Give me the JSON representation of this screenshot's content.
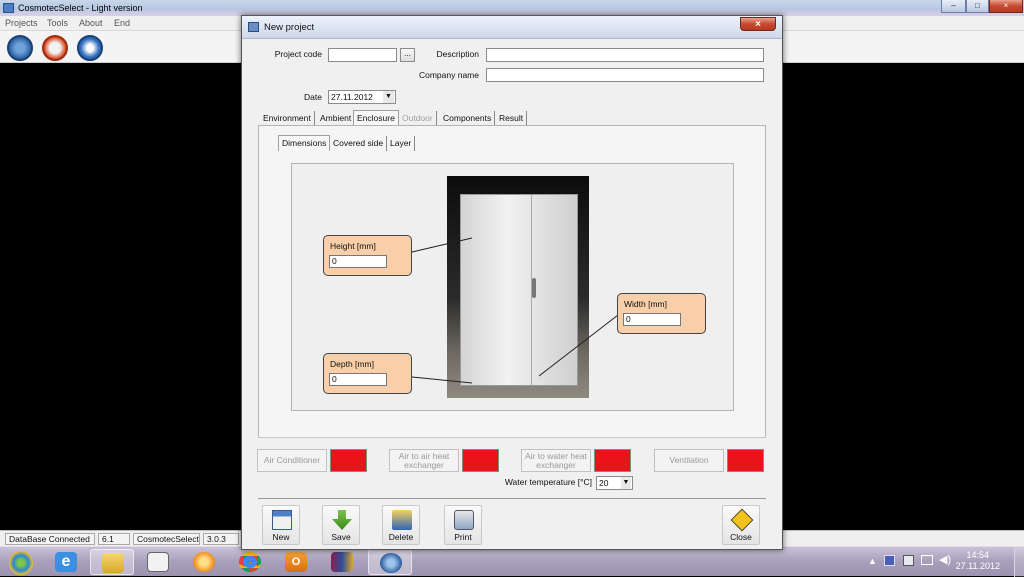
{
  "app": {
    "title": "CosmotecSelect - Light version",
    "menu": [
      "Projects",
      "Tools",
      "About",
      "End"
    ]
  },
  "status": {
    "connection": "DataBase Connected",
    "db_version": "6.1",
    "app_name": "CosmotecSelect",
    "app_version": "3.0.3"
  },
  "dialog": {
    "title": "New project",
    "close_label": "×",
    "project_code_label": "Project code",
    "project_code_value": "",
    "browse_label": "...",
    "description_label": "Description",
    "description_value": "",
    "company_label": "Company name",
    "company_value": "",
    "date_label": "Date",
    "date_value": "27.11.2012",
    "tabs": [
      "Environment",
      "Ambient",
      "Enclosure",
      "Outdoor",
      "Components",
      "Result"
    ],
    "subtabs": [
      "Dimensions",
      "Covered side",
      "Layer"
    ],
    "height_label": "Height [mm]",
    "height_value": "0",
    "width_label": "Width [mm]",
    "width_value": "0",
    "depth_label": "Depth [mm]",
    "depth_value": "0",
    "systems": {
      "air_conditioner": "Air Conditioner",
      "air_to_air": "Air to air heat exchanger",
      "air_to_water": "Air to water heat exchanger",
      "ventilation": "Ventilation"
    },
    "water_temp_label": "Water temperature [°C]",
    "water_temp_value": "20",
    "actions": {
      "new": "New",
      "save": "Save",
      "delete": "Delete",
      "print": "Print",
      "close": "Close"
    }
  },
  "taskbar": {
    "time": "14:54",
    "date": "27.11.2012"
  },
  "colors": {
    "input_box": "#f8cfa8",
    "indicator_red": "#e8141a"
  }
}
